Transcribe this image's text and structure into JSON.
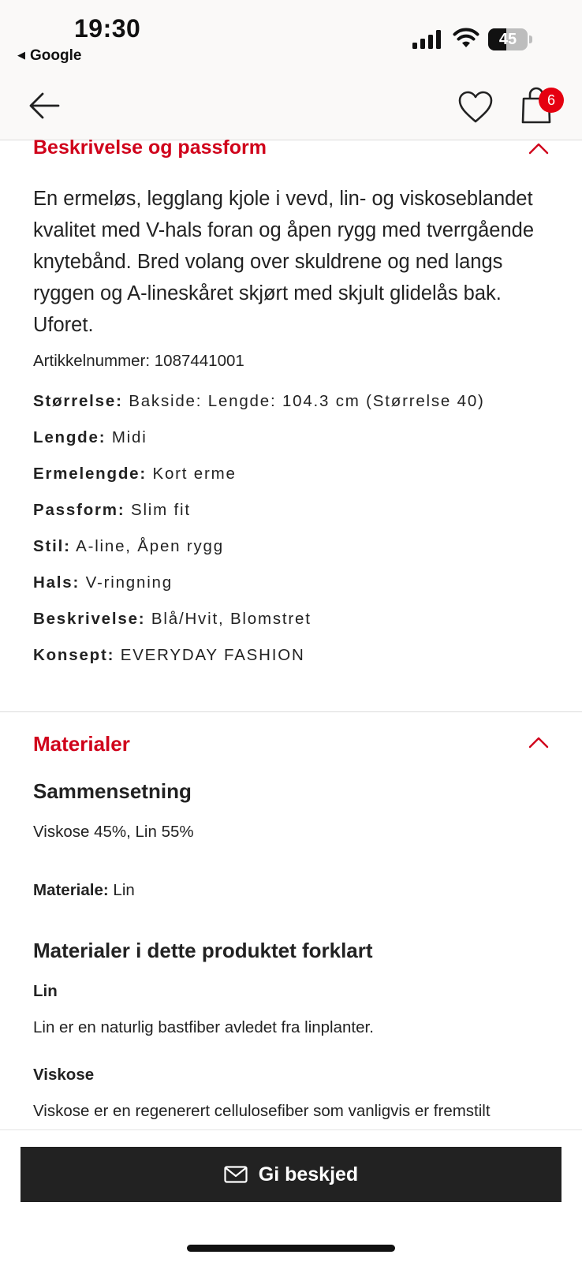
{
  "status_bar": {
    "time": "19:30",
    "back_app": "Google",
    "battery_percent": "45",
    "battery_level": 0.45
  },
  "header": {
    "bag_count": "6"
  },
  "description_section": {
    "title": "Beskrivelse og passform",
    "text": "En ermeløs, legglang kjole i vevd, lin- og viskoseblandet kvalitet med V-hals foran og åpen rygg med tverrgående knytebånd. Bred volang over skuldrene og ned langs ryggen og A-lineskåret skjørt med skjult glidelås bak. Uforet.",
    "article_number": "Artikkelnummer: 1087441001",
    "attributes": [
      {
        "key": "Størrelse:",
        "value": "Bakside: Lengde: 104.3 cm (Størrelse 40)"
      },
      {
        "key": "Lengde:",
        "value": "Midi"
      },
      {
        "key": "Ermelengde:",
        "value": "Kort erme"
      },
      {
        "key": "Passform:",
        "value": "Slim fit"
      },
      {
        "key": "Stil:",
        "value": "A-line, Åpen rygg"
      },
      {
        "key": "Hals:",
        "value": "V-ringning"
      },
      {
        "key": "Beskrivelse:",
        "value": "Blå/Hvit, Blomstret"
      },
      {
        "key": "Konsept:",
        "value": "EVERYDAY FASHION"
      }
    ]
  },
  "materials_section": {
    "title": "Materialer",
    "composition_heading": "Sammensetning",
    "composition": "Viskose 45%, Lin 55%",
    "material_label": "Materiale:",
    "material_value": "Lin",
    "explained_heading": "Materialer i dette produktet forklart",
    "materials": [
      {
        "name": "Lin",
        "text": "Lin er en naturlig bastfiber avledet fra linplanter."
      },
      {
        "name": "Viskose",
        "text": "Viskose er en regenerert cellulosefiber som vanligvis er fremstilt"
      }
    ]
  },
  "cta": {
    "label": "Gi beskjed"
  },
  "colors": {
    "accent_red": "#d0021b",
    "badge_red": "#e50010",
    "button_dark": "#222222"
  },
  "icons": [
    "back-arrow-icon",
    "heart-icon",
    "bag-icon",
    "chevron-up-icon",
    "mail-icon",
    "signal-icon",
    "wifi-icon",
    "battery-icon"
  ]
}
